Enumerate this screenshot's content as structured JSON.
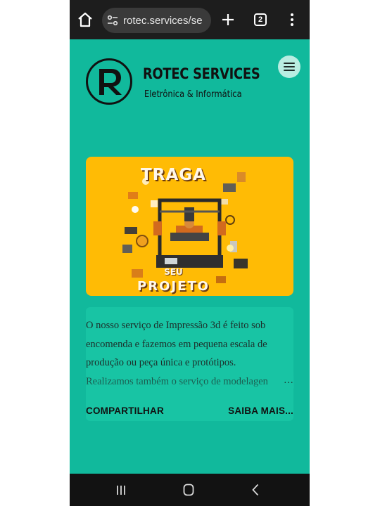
{
  "browser": {
    "url": "rotec.services/se",
    "tab_count": "2"
  },
  "header": {
    "brand_title": "ROTEC SERVICES",
    "brand_subtitle": "Eletrônica & Informática",
    "logo_letter": "R"
  },
  "promo": {
    "top_text": "TRAGA",
    "mid_text": "SEU",
    "bottom_text": "PROJETO"
  },
  "card": {
    "lines": [
      "O nosso serviço de Impressão 3d é feito sob",
      "encomenda e fazemos em pequena escala de",
      "produção ou peça única e protótipos.",
      "Realizamos também o serviço de modelagen"
    ],
    "ellipsis": "…",
    "share_label": "COMPARTILHAR",
    "more_label": "SAIBA MAIS..."
  },
  "colors": {
    "page_background": "#11b99c",
    "card_background": "#18c4a4",
    "promo_background": "#ffbb05",
    "menu_button": "#b9ede2",
    "browser_bar": "#1d1d1d"
  },
  "icons": {
    "home": "home-icon",
    "site_info": "tune-icon",
    "new_tab": "plus-icon",
    "tabs": "tab-counter-icon",
    "overflow": "more-vert-icon",
    "menu": "hamburger-icon",
    "nav_recents": "recents-icon",
    "nav_home": "nav-home-icon",
    "nav_back": "back-icon"
  }
}
